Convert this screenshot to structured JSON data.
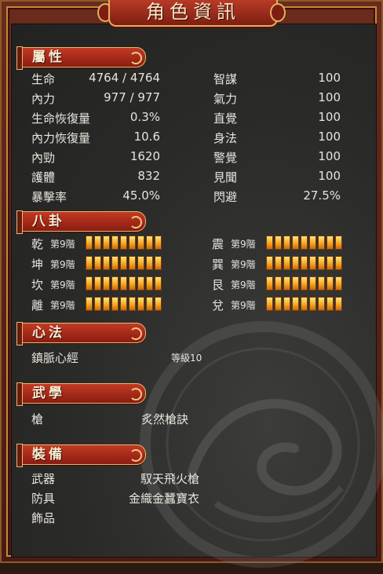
{
  "window": {
    "title": "角色資訊"
  },
  "attributes": {
    "header": "屬性",
    "left": [
      {
        "label": "生命",
        "value": "4764 / 4764"
      },
      {
        "label": "內力",
        "value": "977 / 977"
      },
      {
        "label": "生命恢復量",
        "value": "0.3%"
      },
      {
        "label": "內力恢復量",
        "value": "10.6"
      },
      {
        "label": "內勁",
        "value": "1620"
      },
      {
        "label": "護體",
        "value": "832"
      },
      {
        "label": "暴擊率",
        "value": "45.0%"
      }
    ],
    "right": [
      {
        "label": "智謀",
        "value": "100"
      },
      {
        "label": "氣力",
        "value": "100"
      },
      {
        "label": "直覺",
        "value": "100"
      },
      {
        "label": "身法",
        "value": "100"
      },
      {
        "label": "警覺",
        "value": "100"
      },
      {
        "label": "見聞",
        "value": "100"
      },
      {
        "label": "閃避",
        "value": "27.5%"
      }
    ]
  },
  "bagua": {
    "header": "八卦",
    "left": [
      {
        "name": "乾",
        "rank": "第9階",
        "level": 9,
        "max": 9
      },
      {
        "name": "坤",
        "rank": "第9階",
        "level": 9,
        "max": 9
      },
      {
        "name": "坎",
        "rank": "第9階",
        "level": 9,
        "max": 9
      },
      {
        "name": "離",
        "rank": "第9階",
        "level": 9,
        "max": 9
      }
    ],
    "right": [
      {
        "name": "震",
        "rank": "第9階",
        "level": 9,
        "max": 9
      },
      {
        "name": "巽",
        "rank": "第9階",
        "level": 9,
        "max": 9
      },
      {
        "name": "艮",
        "rank": "第9階",
        "level": 9,
        "max": 9
      },
      {
        "name": "兌",
        "rank": "第9階",
        "level": 9,
        "max": 9
      }
    ]
  },
  "xinfa": {
    "header": "心法",
    "name": "鎮脈心經",
    "level": "等級10"
  },
  "wuxue": {
    "header": "武學",
    "label": "槍",
    "value": "炙然槍訣"
  },
  "equipment": {
    "header": "裝備",
    "items": [
      {
        "label": "武器",
        "value": "馭天飛火槍"
      },
      {
        "label": "防具",
        "value": "金織金蠶寶衣"
      },
      {
        "label": "飾品",
        "value": ""
      }
    ]
  },
  "colors": {
    "bar": "#f2a020",
    "banner": "#b3321e",
    "gold": "#e0b060"
  }
}
